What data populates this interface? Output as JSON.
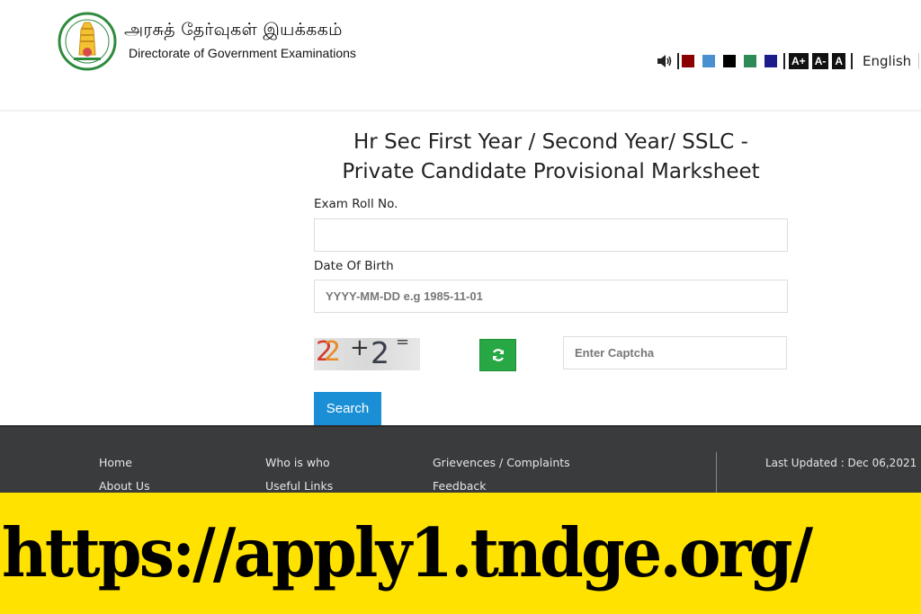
{
  "header": {
    "title_tamil": "அரசுத் தேர்வுகள் இயக்ககம்",
    "title_english": "Directorate of Government Examinations",
    "logo_icon": "tamil-nadu-emblem-icon",
    "toolbar": {
      "speaker_icon": "speaker-icon",
      "color_themes": [
        {
          "name": "maroon",
          "color": "#8b0000"
        },
        {
          "name": "blue",
          "color": "#4a8fcf"
        },
        {
          "name": "black",
          "color": "#000000"
        },
        {
          "name": "green",
          "color": "#2e8b57"
        },
        {
          "name": "navy",
          "color": "#1c1c8a"
        }
      ],
      "font_sizes": [
        "A+",
        "A-",
        "A"
      ],
      "language": "English"
    }
  },
  "form": {
    "title_line1": "Hr Sec First Year / Second Year/ SSLC -",
    "title_line2": "Private Candidate Provisional Marksheet",
    "roll_label": "Exam Roll No.",
    "roll_value": "",
    "roll_placeholder": "",
    "dob_label": "Date Of Birth",
    "dob_value": "",
    "dob_placeholder": "YYYY-MM-DD e.g 1985-11-01",
    "captcha": {
      "expression": "22 + 2 =",
      "parts": [
        "2",
        "2",
        "+",
        "2",
        "="
      ],
      "refresh_icon": "refresh-icon",
      "input_placeholder": "Enter Captcha",
      "input_value": ""
    },
    "search_label": "Search",
    "colors": {
      "search": "#1a8fd6",
      "refresh": "#28a745"
    }
  },
  "footer": {
    "links": [
      [
        "Home",
        "About Us"
      ],
      [
        "Who is who",
        "Useful Links"
      ],
      [
        "Grievences / Complaints",
        "Feedback"
      ]
    ],
    "last_updated": "Last Updated : Dec 06,2021"
  },
  "banner": {
    "url_text": "https://apply1.tndge.org/",
    "background": "#ffe200"
  }
}
